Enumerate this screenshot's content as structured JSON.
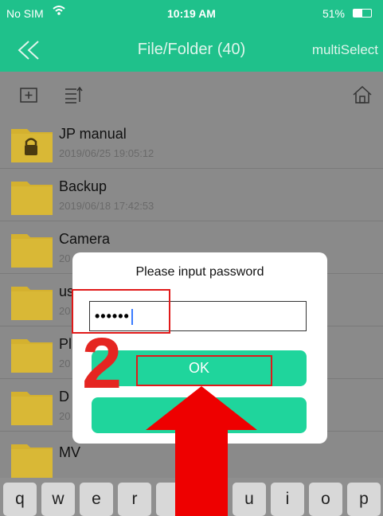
{
  "status_bar": {
    "carrier": "No SIM",
    "time": "10:19 AM",
    "battery": "51%",
    "battery_level": 0.51
  },
  "nav": {
    "back_icon": "double-chevron-left-icon",
    "title": "File/Folder (40)",
    "multi_select": "multiSelect"
  },
  "toolbar": {
    "icons": [
      "new-folder-icon",
      "sort-icon",
      "home-icon"
    ]
  },
  "files": [
    {
      "name": "JP manual",
      "date": "2019/06/25 19:05:12",
      "locked": true
    },
    {
      "name": "Backup",
      "date": "2019/06/18 17:42:53",
      "locked": false
    },
    {
      "name": "Camera",
      "date": "20",
      "locked": false
    },
    {
      "name": "us",
      "date": "20",
      "locked": false
    },
    {
      "name": "Pl",
      "date": "20",
      "locked": false
    },
    {
      "name": "D",
      "date": "20",
      "locked": false
    },
    {
      "name": "MV",
      "date": "",
      "locked": false
    }
  ],
  "dialog": {
    "prompt": "Please input password",
    "password_value": "••••••",
    "ok_label": "OK",
    "second_label": ""
  },
  "annotation": {
    "step_number": "2"
  },
  "keyboard": {
    "keys": [
      "q",
      "w",
      "e",
      "r",
      "",
      "",
      "u",
      "i",
      "o",
      "p"
    ]
  },
  "colors": {
    "accent": "#1fc18b",
    "button": "#1fd59c",
    "folder": "#d4b12f",
    "annotation_red": "#e52521"
  }
}
